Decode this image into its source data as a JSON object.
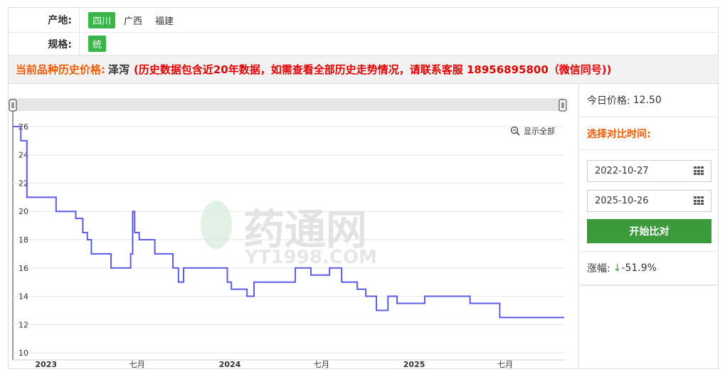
{
  "filters": {
    "origin": {
      "label": "产地:",
      "options": [
        "四川",
        "广西",
        "福建"
      ],
      "selected": 0
    },
    "spec": {
      "label": "规格:",
      "options": [
        "统"
      ],
      "selected": 0
    }
  },
  "banner": {
    "label": "当前品种历史价格:",
    "name": "泽泻",
    "note": "(历史数据包含近20年数据，如需查看全部历史走势情况，请联系客服 18956895800（微信同号))"
  },
  "side": {
    "today_label": "今日价格:",
    "today_value": "12.50",
    "compare_label": "选择对比时间:",
    "start_date": "2022-10-27",
    "end_date": "2025-10-26",
    "button": "开始比对",
    "change_label": "涨幅:",
    "change_arrow": "↓",
    "change_value": "-51.9%"
  },
  "chart": {
    "show_all": "显示全部",
    "watermark_cn": "药通网",
    "watermark_en": "YT1998.COM",
    "line_color": "#5b5bea"
  },
  "chart_data": {
    "type": "line",
    "step": true,
    "x_range": [
      "2022-10-27",
      "2025-10-26"
    ],
    "ylim": [
      9.5,
      26.6
    ],
    "yticks": [
      10,
      12,
      14,
      16,
      18,
      20,
      22,
      24,
      26
    ],
    "xticks": [
      {
        "date": "2023-01-01",
        "label": "2023",
        "bold": true
      },
      {
        "date": "2023-07-01",
        "label": "七月",
        "bold": false
      },
      {
        "date": "2024-01-01",
        "label": "2024",
        "bold": true
      },
      {
        "date": "2024-07-01",
        "label": "七月",
        "bold": false
      },
      {
        "date": "2025-01-01",
        "label": "2025",
        "bold": true
      },
      {
        "date": "2025-07-01",
        "label": "七月",
        "bold": false
      }
    ],
    "grid": true,
    "series": [
      {
        "points": [
          [
            "2022-10-27",
            26
          ],
          [
            "2022-11-12",
            25
          ],
          [
            "2022-11-24",
            21
          ],
          [
            "2023-01-21",
            20
          ],
          [
            "2023-03-01",
            19.5
          ],
          [
            "2023-03-15",
            18.5
          ],
          [
            "2023-03-24",
            18
          ],
          [
            "2023-04-01",
            17
          ],
          [
            "2023-05-10",
            16
          ],
          [
            "2023-06-18",
            17
          ],
          [
            "2023-06-22",
            20
          ],
          [
            "2023-06-26",
            18.5
          ],
          [
            "2023-07-05",
            18
          ],
          [
            "2023-08-05",
            17
          ],
          [
            "2023-09-10",
            16
          ],
          [
            "2023-09-21",
            15
          ],
          [
            "2023-10-01",
            16
          ],
          [
            "2023-12-27",
            15
          ],
          [
            "2024-01-04",
            14.5
          ],
          [
            "2024-02-04",
            14
          ],
          [
            "2024-02-18",
            15
          ],
          [
            "2024-05-10",
            16
          ],
          [
            "2024-06-10",
            15.5
          ],
          [
            "2024-07-17",
            16
          ],
          [
            "2024-08-10",
            15
          ],
          [
            "2024-09-10",
            14.5
          ],
          [
            "2024-09-27",
            14
          ],
          [
            "2024-10-18",
            13
          ],
          [
            "2024-11-10",
            14
          ],
          [
            "2024-11-28",
            13.5
          ],
          [
            "2025-01-22",
            14
          ],
          [
            "2025-04-22",
            13.5
          ],
          [
            "2025-06-20",
            12.5
          ],
          [
            "2025-10-26",
            12.5
          ]
        ]
      }
    ]
  }
}
